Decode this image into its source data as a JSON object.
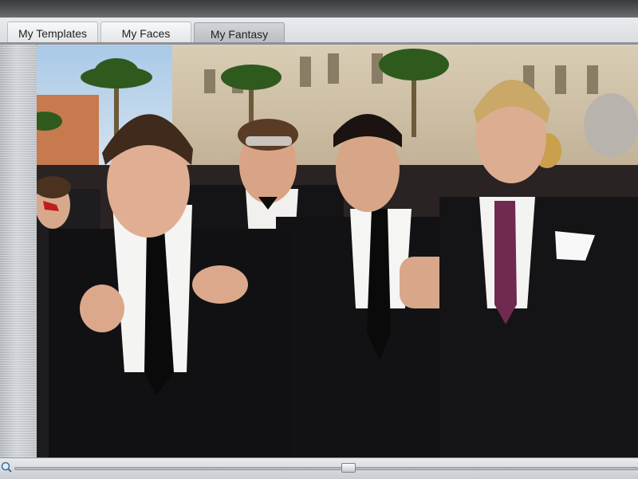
{
  "tabs": [
    {
      "label": "My Templates",
      "active": false
    },
    {
      "label": "My Faces",
      "active": false
    },
    {
      "label": "My Fantasy",
      "active": true
    }
  ],
  "photo": {
    "content": "red-carpet group photo of four men in black tuxedos"
  },
  "slider": {
    "position": 0.55
  },
  "colors": {
    "topbar": "#4a4b4e",
    "tab_active": "#c4c6c9",
    "panel": "#c9ccd0"
  }
}
